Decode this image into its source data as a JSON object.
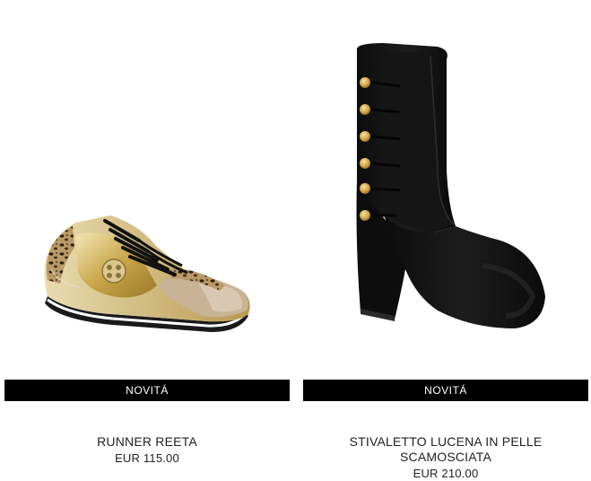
{
  "theme": {
    "badge_bg": "#000000",
    "badge_text": "#ffffff",
    "text": "#222222"
  },
  "products": [
    {
      "badge": "NOVITÁ",
      "name": "RUNNER REETA",
      "price": "EUR 115.00",
      "image_icon": "gold-leopard-sneaker-image"
    },
    {
      "badge": "NOVITÁ",
      "name": "STIVALETTO LUCENA IN PELLE SCAMOSCIATA",
      "price": "EUR 210.00",
      "image_icon": "black-suede-ankle-boot-image"
    }
  ]
}
